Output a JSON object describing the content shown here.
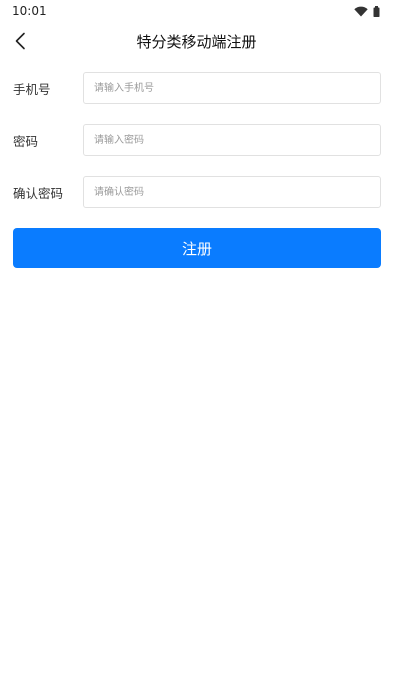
{
  "status_bar": {
    "time": "10:01",
    "icons": [
      "wifi-icon",
      "battery-icon"
    ]
  },
  "nav": {
    "back_icon": "chevron-left-icon",
    "title": "特分类移动端注册"
  },
  "form": {
    "phone": {
      "label": "手机号",
      "placeholder": "请输入手机号",
      "value": ""
    },
    "password": {
      "label": "密码",
      "placeholder": "请输入密码",
      "value": ""
    },
    "confirm_password": {
      "label": "确认密码",
      "placeholder": "请确认密码",
      "value": ""
    }
  },
  "submit": {
    "label": "注册"
  },
  "colors": {
    "primary": "#0a7cff",
    "input_border": "#e1e1e1",
    "placeholder": "#9a9a9a"
  }
}
